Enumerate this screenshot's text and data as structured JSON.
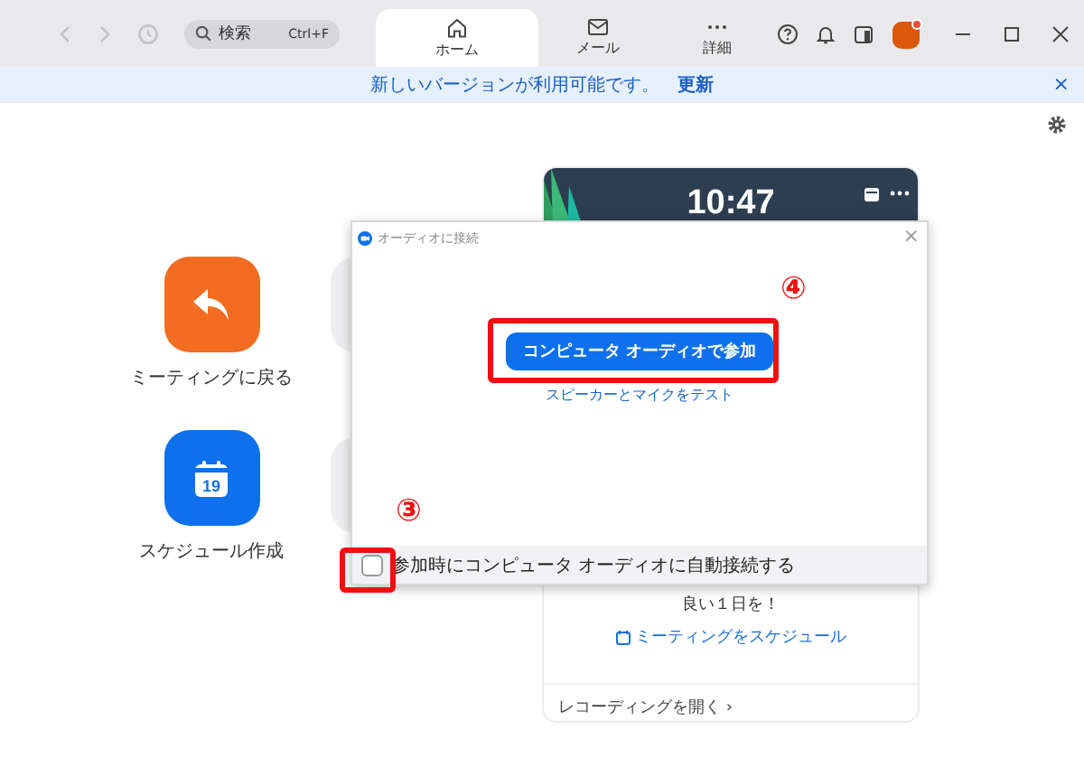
{
  "toolbar": {
    "search": {
      "placeholder": "検索",
      "shortcut": "Ctrl+F"
    },
    "tabs": [
      {
        "label": "ホーム",
        "kind": "home",
        "selected": true
      },
      {
        "label": "メール",
        "kind": "mail",
        "selected": false
      },
      {
        "label": "詳細",
        "kind": "more",
        "selected": false
      }
    ]
  },
  "banner": {
    "message": "新しいバージョンが利用可能です。",
    "link": "更新",
    "close": "×"
  },
  "actions": [
    {
      "label": "ミーティングに戻る",
      "kind": "back",
      "color": "#f26d21"
    },
    {
      "label": "スケジュール作成",
      "kind": "calendar",
      "color": "#0e71eb",
      "day": "19"
    }
  ],
  "card": {
    "time": "10:47",
    "greeting": "良い１日を！",
    "schedule_link": "ミーティングをスケジュール",
    "recordings_link": "レコーディングを開く ›"
  },
  "dialog": {
    "title": "オーディオに接続",
    "primary_button": "コンピュータ オーディオで参加",
    "test_link": "スピーカーとマイクをテスト",
    "close": "×",
    "auto_join": {
      "label": "参加時にコンピュータ オーディオに自動接続する",
      "checked": false
    }
  },
  "annotations": [
    {
      "number": "④",
      "kind": "button"
    },
    {
      "number": "③",
      "kind": "checkbox"
    }
  ]
}
